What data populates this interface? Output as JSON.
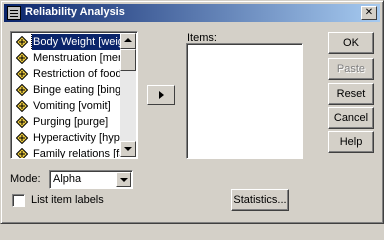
{
  "window": {
    "title": "Reliability Analysis",
    "close_glyph": "✕"
  },
  "variables": [
    {
      "label": "Body Weight [weig",
      "selected": true
    },
    {
      "label": "Menstruation [mens",
      "selected": false
    },
    {
      "label": "Restriction of food i",
      "selected": false
    },
    {
      "label": "Binge eating [binge",
      "selected": false
    },
    {
      "label": "Vomiting [vomit]",
      "selected": false
    },
    {
      "label": "Purging [purge]",
      "selected": false
    },
    {
      "label": "Hyperactivity [hype",
      "selected": false
    },
    {
      "label": "Family relations [fan",
      "selected": false
    }
  ],
  "variable_icon": "scale-variable-icon",
  "items": {
    "label": "Items:",
    "values": []
  },
  "buttons": {
    "ok": "OK",
    "paste": "Paste",
    "reset": "Reset",
    "cancel": "Cancel",
    "help": "Help",
    "statistics": "Statistics..."
  },
  "mode": {
    "label": "Mode:",
    "value": "Alpha"
  },
  "list_item_labels": {
    "label": "List item labels",
    "checked": false
  },
  "colors": {
    "title_start": "#0a246a",
    "title_end": "#a6caf0",
    "face": "#d4d0c8",
    "selection": "#0a246a"
  }
}
